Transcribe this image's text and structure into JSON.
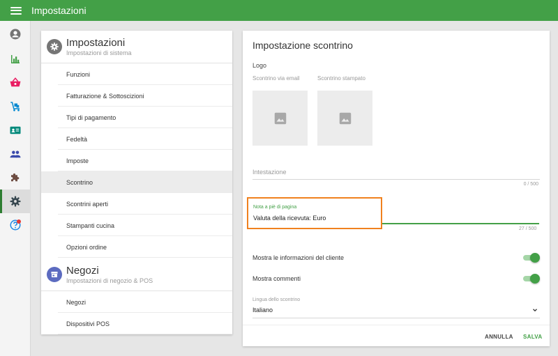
{
  "app": {
    "title": "Impostazioni"
  },
  "colors": {
    "primary": "#43a047",
    "highlight": "#f0811e",
    "section_icon": "#5c6bc0"
  },
  "sidebar": {
    "icons": [
      "account-icon",
      "bar-chart-icon",
      "basket-icon",
      "cart-icon",
      "id-card-icon",
      "people-icon",
      "puzzle-icon",
      "gear-icon",
      "help-icon"
    ],
    "active": "gear-icon"
  },
  "settings": {
    "title": "Impostazioni",
    "subtitle": "Impostazioni di sistema",
    "items": [
      "Funzioni",
      "Fatturazione & Sottoscizioni",
      "Tipi di pagamento",
      "Fedeltà",
      "Imposte",
      "Scontrino",
      "Scontrini aperti",
      "Stampanti cucina",
      "Opzioni ordine"
    ],
    "selected": "Scontrino"
  },
  "stores": {
    "title": "Negozi",
    "subtitle": "Impostazioni di negozio & POS",
    "items": [
      "Negozi",
      "Dispositivi POS"
    ]
  },
  "receipt": {
    "title": "Impostazione scontrino",
    "logo_label": "Logo",
    "email_logo_label": "Scontrino via email",
    "printed_logo_label": "Scontrino stampato",
    "header_label": "Intestazione",
    "header_counter": "0 / 500",
    "footer_label": "Nota a piè di pagina",
    "footer_value": "Valuta della ricevuta: Euro",
    "footer_counter": "27 / 500",
    "show_customer_info_label": "Mostra le informazioni del cliente",
    "show_customer_info": true,
    "show_comments_label": "Mostra commenti",
    "show_comments": true,
    "language_label": "Lingua dello scontrino",
    "language_value": "Italiano",
    "cancel_label": "ANNULLA",
    "save_label": "SALVA"
  }
}
